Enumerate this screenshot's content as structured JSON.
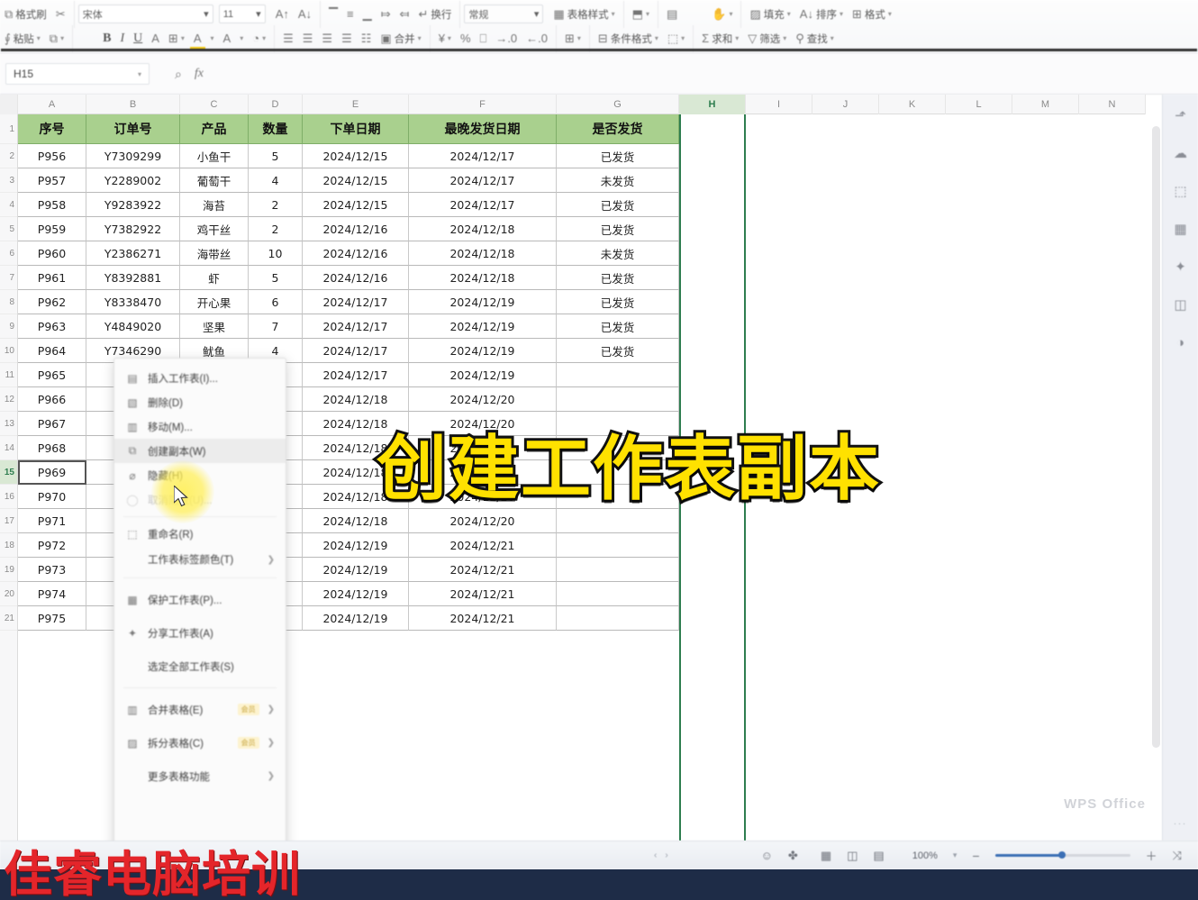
{
  "toolbar": {
    "row1": [
      {
        "icon": "clipboard-icon",
        "label": "格式刷",
        "glyph": "⬚"
      },
      {
        "icon": "cut-icon",
        "label": "",
        "glyph": "✂"
      },
      {
        "icon": "font-name",
        "label": "宋体",
        "glyph": ""
      },
      {
        "icon": "font-size",
        "label": "11",
        "glyph": ""
      },
      {
        "icon": "grow-font-icon",
        "label": "A",
        "glyph": ""
      },
      {
        "icon": "shrink-font-icon",
        "label": "A",
        "glyph": ""
      },
      {
        "icon": "align-top-icon",
        "label": "",
        "glyph": "▔"
      },
      {
        "icon": "align-middle-icon",
        "label": "",
        "glyph": "≡"
      },
      {
        "icon": "align-bottom-icon",
        "label": "",
        "glyph": "▁"
      },
      {
        "icon": "indent-decrease-icon",
        "label": "",
        "glyph": "⤇"
      },
      {
        "icon": "indent-increase-icon",
        "label": "",
        "glyph": "⤆"
      },
      {
        "icon": "wrap-text-icon",
        "label": "换行",
        "glyph": "↵"
      },
      {
        "icon": "number-format",
        "label": "常规",
        "glyph": ""
      },
      {
        "icon": "cell-style-icon",
        "label": "表格样式",
        "glyph": "▦"
      },
      {
        "icon": "row-col-icon",
        "label": "",
        "glyph": "⬒"
      },
      {
        "icon": "worksheet-icon",
        "label": "",
        "glyph": "▤"
      },
      {
        "icon": "format-brush-icon",
        "label": "",
        "glyph": "✋"
      },
      {
        "icon": "fill-icon",
        "label": "填充",
        "glyph": "▨"
      },
      {
        "icon": "sort-icon",
        "label": "排序",
        "glyph": "A↓"
      },
      {
        "icon": "format-icon",
        "label": "格式",
        "glyph": "⊞"
      }
    ],
    "row2": [
      {
        "icon": "paste-icon",
        "label": "粘贴",
        "glyph": "⬚"
      },
      {
        "icon": "copy-icon",
        "label": "复制",
        "glyph": "⧉"
      },
      {
        "icon": "bold-icon",
        "label": "B",
        "glyph": ""
      },
      {
        "icon": "italic-icon",
        "label": "I",
        "glyph": ""
      },
      {
        "icon": "underline-icon",
        "label": "U",
        "glyph": ""
      },
      {
        "icon": "strikethrough-icon",
        "label": "A",
        "glyph": ""
      },
      {
        "icon": "border-icon",
        "label": "",
        "glyph": "⊞"
      },
      {
        "icon": "highlight-color-icon",
        "label": "",
        "glyph": "A"
      },
      {
        "icon": "font-color-icon",
        "label": "",
        "glyph": "A"
      },
      {
        "icon": "cell-color-icon",
        "label": "",
        "glyph": "◔"
      },
      {
        "icon": "align-left-icon",
        "label": "",
        "glyph": "☰"
      },
      {
        "icon": "align-center-icon",
        "label": "",
        "glyph": "☰"
      },
      {
        "icon": "align-right-icon",
        "label": "",
        "glyph": "☰"
      },
      {
        "icon": "justify-icon",
        "label": "",
        "glyph": "☰"
      },
      {
        "icon": "distribute-icon",
        "label": "",
        "glyph": "☷"
      },
      {
        "icon": "merge-cells-icon",
        "label": "合并",
        "glyph": "▣"
      },
      {
        "icon": "currency-icon",
        "label": "",
        "glyph": "¥"
      },
      {
        "icon": "percent-icon",
        "label": "",
        "glyph": "%"
      },
      {
        "icon": "comma-icon",
        "label": "",
        "glyph": "⎕"
      },
      {
        "icon": "increase-decimal-icon",
        "label": "",
        "glyph": "↓·"
      },
      {
        "icon": "decrease-decimal-icon",
        "label": "",
        "glyph": "↑·"
      },
      {
        "icon": "insert-cells-icon",
        "label": "",
        "glyph": "⊞"
      },
      {
        "icon": "conditional-format-icon",
        "label": "条件格式",
        "glyph": "⊟"
      },
      {
        "icon": "table-style-icon",
        "label": "",
        "glyph": "⬚"
      },
      {
        "icon": "autosum-icon",
        "label": "求和",
        "glyph": "Σ"
      },
      {
        "icon": "filter-icon",
        "label": "筛选",
        "glyph": "▽"
      },
      {
        "icon": "find-icon",
        "label": "查找",
        "glyph": "⚲"
      }
    ]
  },
  "formula_bar": {
    "name_box_value": "H15",
    "name_box_caret": "▾",
    "insert_function_icon": "fx",
    "search_icon": "⌕",
    "formula_value": ""
  },
  "grid": {
    "columns": [
      "A",
      "B",
      "C",
      "D",
      "E",
      "F",
      "G",
      "H",
      "I",
      "J",
      "K",
      "L",
      "M",
      "N"
    ],
    "selected_column": "H",
    "selected_cell": "H15",
    "rows": [
      "1",
      "2",
      "3",
      "4",
      "5",
      "6",
      "7",
      "8",
      "9",
      "10",
      "11",
      "12",
      "13",
      "14",
      "15",
      "16",
      "17",
      "18",
      "19",
      "20",
      "21"
    ],
    "selected_row": "15",
    "headers": [
      "序号",
      "订单号",
      "产品",
      "数量",
      "下单日期",
      "最晚发货日期",
      "是否发货"
    ],
    "data": [
      [
        "P956",
        "Y7309299",
        "小鱼干",
        "5",
        "2024/12/15",
        "2024/12/17",
        "已发货"
      ],
      [
        "P957",
        "Y2289002",
        "葡萄干",
        "4",
        "2024/12/15",
        "2024/12/17",
        "未发货"
      ],
      [
        "P958",
        "Y9283922",
        "海苔",
        "2",
        "2024/12/15",
        "2024/12/17",
        "已发货"
      ],
      [
        "P959",
        "Y7382922",
        "鸡干丝",
        "2",
        "2024/12/16",
        "2024/12/18",
        "已发货"
      ],
      [
        "P960",
        "Y2386271",
        "海带丝",
        "10",
        "2024/12/16",
        "2024/12/18",
        "未发货"
      ],
      [
        "P961",
        "Y8392881",
        "虾",
        "5",
        "2024/12/16",
        "2024/12/18",
        "已发货"
      ],
      [
        "P962",
        "Y8338470",
        "开心果",
        "6",
        "2024/12/17",
        "2024/12/19",
        "已发货"
      ],
      [
        "P963",
        "Y4849020",
        "坚果",
        "7",
        "2024/12/17",
        "2024/12/19",
        "已发货"
      ],
      [
        "P964",
        "Y7346290",
        "鱿鱼",
        "4",
        "2024/12/17",
        "2024/12/19",
        "已发货"
      ],
      [
        "P965",
        "Y2",
        "",
        "",
        "2024/12/17",
        "2024/12/19",
        ""
      ],
      [
        "P966",
        "Y2",
        "",
        "",
        "2024/12/18",
        "2024/12/20",
        ""
      ],
      [
        "P967",
        "Y3",
        "",
        "",
        "2024/12/18",
        "2024/12/20",
        ""
      ],
      [
        "P968",
        "Y5",
        "",
        "",
        "2024/12/18",
        "2024/12/20",
        ""
      ],
      [
        "P969",
        "Y3",
        "",
        "",
        "2024/12/18",
        "2024/12/20",
        ""
      ],
      [
        "P970",
        "Y4",
        "",
        "",
        "2024/12/18",
        "2024/12/20",
        ""
      ],
      [
        "P971",
        "Y4",
        "",
        "",
        "2024/12/18",
        "2024/12/20",
        ""
      ],
      [
        "P972",
        "Y3",
        "",
        "",
        "2024/12/19",
        "2024/12/21",
        ""
      ],
      [
        "P973",
        "Y8",
        "",
        "",
        "2024/12/19",
        "2024/12/21",
        ""
      ],
      [
        "P974",
        "Y8",
        "",
        "",
        "2024/12/19",
        "2024/12/21",
        ""
      ],
      [
        "P975",
        "Y6",
        "",
        "",
        "2024/12/19",
        "2024/12/21",
        ""
      ]
    ]
  },
  "context_menu": {
    "items": [
      {
        "label": "插入工作表(I)...",
        "icon": "insert-sheet-icon",
        "glyph": "▤",
        "arrow": false,
        "disabled": false,
        "hot": false,
        "badge": ""
      },
      {
        "label": "删除(D)",
        "icon": "delete-sheet-icon",
        "glyph": "▧",
        "arrow": false,
        "disabled": false,
        "hot": false,
        "badge": ""
      },
      {
        "label": "移动(M)...",
        "icon": "move-sheet-icon",
        "glyph": "▥",
        "arrow": false,
        "disabled": false,
        "hot": false,
        "badge": ""
      },
      {
        "label": "创建副本(W)",
        "icon": "duplicate-sheet-icon",
        "glyph": "⧉",
        "arrow": false,
        "disabled": false,
        "hot": true,
        "badge": ""
      },
      {
        "label": "隐藏(H)",
        "icon": "hide-sheet-icon",
        "glyph": "⌀",
        "arrow": false,
        "disabled": false,
        "hot": false,
        "badge": ""
      },
      {
        "label": "取消隐藏(U)...",
        "icon": "unhide-sheet-icon",
        "glyph": "◯",
        "arrow": false,
        "disabled": true,
        "hot": false,
        "badge": ""
      },
      {
        "label": "重命名(R)",
        "icon": "rename-sheet-icon",
        "glyph": "⬚",
        "arrow": false,
        "disabled": false,
        "hot": false,
        "badge": ""
      },
      {
        "label": "工作表标签颜色(T)",
        "icon": "tab-color-icon",
        "glyph": "",
        "arrow": true,
        "disabled": false,
        "hot": false,
        "badge": ""
      },
      {
        "label": "保护工作表(P)...",
        "icon": "protect-sheet-icon",
        "glyph": "▦",
        "arrow": false,
        "disabled": false,
        "hot": false,
        "badge": ""
      },
      {
        "label": "分享工作表(A)",
        "icon": "share-sheet-icon",
        "glyph": "✦",
        "arrow": false,
        "disabled": false,
        "hot": false,
        "badge": ""
      },
      {
        "label": "选定全部工作表(S)",
        "icon": "select-all-sheets-icon",
        "glyph": "",
        "arrow": false,
        "disabled": false,
        "hot": false,
        "badge": ""
      },
      {
        "label": "合并表格(E)",
        "icon": "merge-tables-icon",
        "glyph": "▥",
        "arrow": true,
        "disabled": false,
        "hot": false,
        "badge": "会员"
      },
      {
        "label": "拆分表格(C)",
        "icon": "split-tables-icon",
        "glyph": "▨",
        "arrow": true,
        "disabled": false,
        "hot": false,
        "badge": "会员"
      },
      {
        "label": "更多表格功能",
        "icon": "more-features-icon",
        "glyph": "",
        "arrow": true,
        "disabled": false,
        "hot": false,
        "badge": ""
      }
    ]
  },
  "sidebar": {
    "items": [
      {
        "name": "cursor-tool-icon",
        "glyph": "⬏"
      },
      {
        "name": "shapes-tool-icon",
        "glyph": "☁"
      },
      {
        "name": "crop-tool-icon",
        "glyph": "⬚"
      },
      {
        "name": "table-tool-icon",
        "glyph": "▦"
      },
      {
        "name": "chart-tool-icon",
        "glyph": "✦"
      },
      {
        "name": "book-tool-icon",
        "glyph": "◫"
      },
      {
        "name": "theme-tool-icon",
        "glyph": "◑"
      }
    ],
    "more_label": "···"
  },
  "status_bar": {
    "sheet_nav": [
      "‹",
      "›"
    ],
    "right_icons": [
      {
        "name": "accessibility-icon",
        "glyph": "☺"
      },
      {
        "name": "view-layout-icon",
        "glyph": "✤"
      },
      {
        "name": "normal-view-icon",
        "glyph": "▦"
      },
      {
        "name": "page-layout-icon",
        "glyph": "◫"
      },
      {
        "name": "page-break-view-icon",
        "glyph": "▤"
      }
    ],
    "zoom_label": "100%",
    "zoom_caret": "▾",
    "zoom_out": "−",
    "zoom_in": "＋",
    "fullscreen_icon": "⤨"
  },
  "overlay": {
    "title": "创建工作表副本",
    "watermark_left": "佳睿电脑培训",
    "watermark_right": "WPS Office"
  }
}
